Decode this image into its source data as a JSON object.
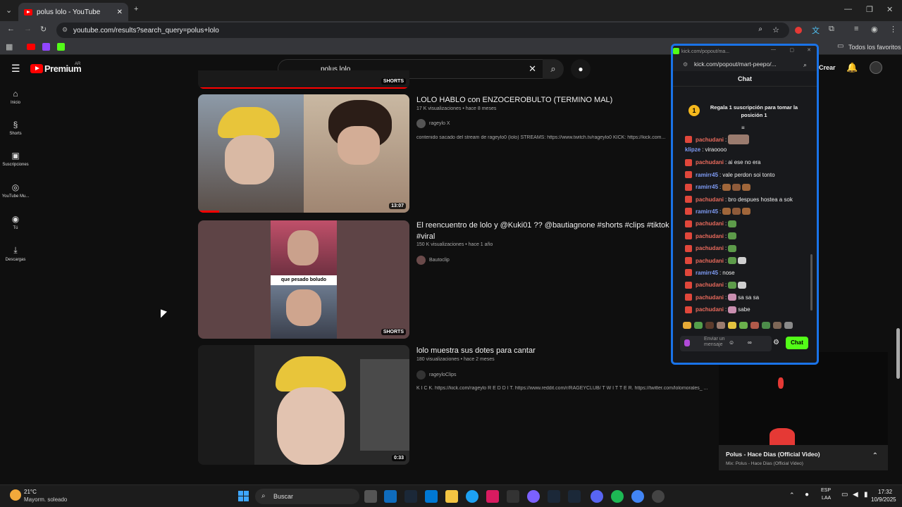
{
  "browser": {
    "tab_title": "polus lolo - YouTube",
    "url": "youtube.com/results?search_query=polus+lolo",
    "bookmarks_label": "Todos los favoritos"
  },
  "youtube": {
    "logo": "Premium",
    "region": "AR",
    "search_value": "polus lolo",
    "create_label": "Crear",
    "sidebar": [
      {
        "label": "Inicio",
        "icon": "home-icon"
      },
      {
        "label": "Shorts",
        "icon": "shorts-icon"
      },
      {
        "label": "Suscripciones",
        "icon": "subscriptions-icon"
      },
      {
        "label": "YouTube Mu...",
        "icon": "music-icon"
      },
      {
        "label": "Tú",
        "icon": "user-icon"
      },
      {
        "label": "Descargas",
        "icon": "download-icon"
      }
    ],
    "top_badge": "SHORTS",
    "videos": [
      {
        "title": "LOLO HABLO con ENZOCEROBULTO (TERMINO MAL)",
        "meta": "17 K visualizaciones • hace 8 meses",
        "channel": "rageylo X",
        "desc": "contenido sacado del stream de rageylo0 (lolo) STREAMS: https://www.twitch.tv/rageylo0 KICK: https://kick.com...",
        "duration": "13:07"
      },
      {
        "title": "El reencuentro de lolo y @Kuki01 ?? @bautiagnone #shorts #clips #tiktok #",
        "title2": "#viral",
        "meta": "150 K visualizaciones • hace 1 año",
        "channel": "Bautoclip",
        "caption": "que pesado boludo",
        "duration": "SHORTS"
      },
      {
        "title": "lolo muestra sus dotes para cantar",
        "meta": "180 visualizaciones • hace 2 meses",
        "channel": "rageyloClips",
        "desc": "K I C K. https://kick.com/rageylo R E D D I T. https://www.reddit.com/r/RAGEYCLUB/ T W I T T E R. https://twitter.com/lolomorales_ ...",
        "duration": "0:33"
      }
    ]
  },
  "kick": {
    "window_title": "kick.com/popout/ma...",
    "url": "kick.com/popout/mart-peepo/...",
    "chat_header": "Chat",
    "promo": "Regala 1 suscripción para tomar la posición 1",
    "promo_rank": "1",
    "messages": [
      {
        "user": "pachudani",
        "text": "",
        "user_color": "#e86a5c"
      },
      {
        "user": "klipze",
        "text": "viraoooo",
        "user_color": "#7f9cf5"
      },
      {
        "user": "pachudani",
        "text": "ai ese no era",
        "user_color": "#e86a5c"
      },
      {
        "user": "ramirr45",
        "text": "vale perdon soi tonto",
        "user_color": "#7f9cf5"
      },
      {
        "user": "ramirr45",
        "text": "",
        "user_color": "#7f9cf5"
      },
      {
        "user": "pachudani",
        "text": "bro despues hostea a sok",
        "user_color": "#e86a5c"
      },
      {
        "user": "ramirr45",
        "text": "",
        "user_color": "#7f9cf5"
      },
      {
        "user": "pachudani",
        "text": "",
        "user_color": "#e86a5c"
      },
      {
        "user": "pachudani",
        "text": "",
        "user_color": "#e86a5c"
      },
      {
        "user": "pachudani",
        "text": "",
        "user_color": "#e86a5c"
      },
      {
        "user": "pachudani",
        "text": "",
        "user_color": "#e86a5c"
      },
      {
        "user": "ramirr45",
        "text": "nose",
        "user_color": "#7f9cf5"
      },
      {
        "user": "pachudani",
        "text": "",
        "user_color": "#e86a5c"
      },
      {
        "user": "pachudani",
        "text": "sa sa sa",
        "user_color": "#e86a5c"
      },
      {
        "user": "pachudani",
        "text": "sabe",
        "user_color": "#e86a5c"
      }
    ],
    "input_placeholder": "Enviar un mensaje",
    "send_label": "Chat"
  },
  "miniplayer": {
    "title": "Polus - Hace Dias (Official Video)",
    "subtitle": "Mix: Polus - Hace Dias (Official Video)"
  },
  "taskbar": {
    "temp": "21°C",
    "weather": "Mayorm. soleado",
    "search": "Buscar",
    "lang1": "ESP",
    "lang2": "LAA",
    "time": "17:32",
    "date": "10/9/2025"
  }
}
